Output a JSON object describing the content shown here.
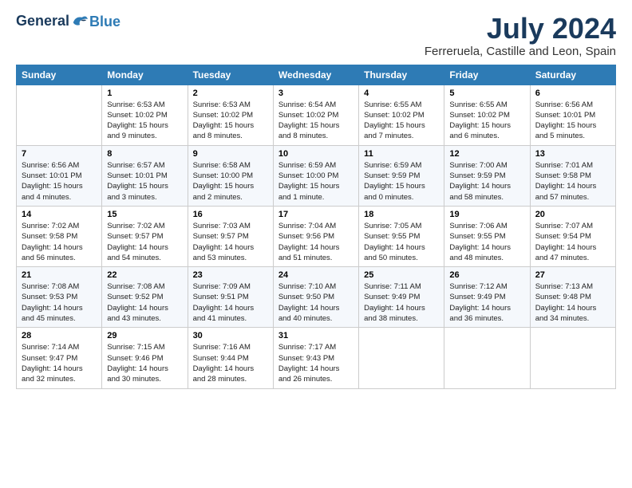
{
  "logo": {
    "line1": "General",
    "line2": "Blue"
  },
  "title": "July 2024",
  "subtitle": "Ferreruela, Castille and Leon, Spain",
  "days_header": [
    "Sunday",
    "Monday",
    "Tuesday",
    "Wednesday",
    "Thursday",
    "Friday",
    "Saturday"
  ],
  "weeks": [
    [
      {
        "num": "",
        "info": ""
      },
      {
        "num": "1",
        "info": "Sunrise: 6:53 AM\nSunset: 10:02 PM\nDaylight: 15 hours\nand 9 minutes."
      },
      {
        "num": "2",
        "info": "Sunrise: 6:53 AM\nSunset: 10:02 PM\nDaylight: 15 hours\nand 8 minutes."
      },
      {
        "num": "3",
        "info": "Sunrise: 6:54 AM\nSunset: 10:02 PM\nDaylight: 15 hours\nand 8 minutes."
      },
      {
        "num": "4",
        "info": "Sunrise: 6:55 AM\nSunset: 10:02 PM\nDaylight: 15 hours\nand 7 minutes."
      },
      {
        "num": "5",
        "info": "Sunrise: 6:55 AM\nSunset: 10:02 PM\nDaylight: 15 hours\nand 6 minutes."
      },
      {
        "num": "6",
        "info": "Sunrise: 6:56 AM\nSunset: 10:01 PM\nDaylight: 15 hours\nand 5 minutes."
      }
    ],
    [
      {
        "num": "7",
        "info": "Sunrise: 6:56 AM\nSunset: 10:01 PM\nDaylight: 15 hours\nand 4 minutes."
      },
      {
        "num": "8",
        "info": "Sunrise: 6:57 AM\nSunset: 10:01 PM\nDaylight: 15 hours\nand 3 minutes."
      },
      {
        "num": "9",
        "info": "Sunrise: 6:58 AM\nSunset: 10:00 PM\nDaylight: 15 hours\nand 2 minutes."
      },
      {
        "num": "10",
        "info": "Sunrise: 6:59 AM\nSunset: 10:00 PM\nDaylight: 15 hours\nand 1 minute."
      },
      {
        "num": "11",
        "info": "Sunrise: 6:59 AM\nSunset: 9:59 PM\nDaylight: 15 hours\nand 0 minutes."
      },
      {
        "num": "12",
        "info": "Sunrise: 7:00 AM\nSunset: 9:59 PM\nDaylight: 14 hours\nand 58 minutes."
      },
      {
        "num": "13",
        "info": "Sunrise: 7:01 AM\nSunset: 9:58 PM\nDaylight: 14 hours\nand 57 minutes."
      }
    ],
    [
      {
        "num": "14",
        "info": "Sunrise: 7:02 AM\nSunset: 9:58 PM\nDaylight: 14 hours\nand 56 minutes."
      },
      {
        "num": "15",
        "info": "Sunrise: 7:02 AM\nSunset: 9:57 PM\nDaylight: 14 hours\nand 54 minutes."
      },
      {
        "num": "16",
        "info": "Sunrise: 7:03 AM\nSunset: 9:57 PM\nDaylight: 14 hours\nand 53 minutes."
      },
      {
        "num": "17",
        "info": "Sunrise: 7:04 AM\nSunset: 9:56 PM\nDaylight: 14 hours\nand 51 minutes."
      },
      {
        "num": "18",
        "info": "Sunrise: 7:05 AM\nSunset: 9:55 PM\nDaylight: 14 hours\nand 50 minutes."
      },
      {
        "num": "19",
        "info": "Sunrise: 7:06 AM\nSunset: 9:55 PM\nDaylight: 14 hours\nand 48 minutes."
      },
      {
        "num": "20",
        "info": "Sunrise: 7:07 AM\nSunset: 9:54 PM\nDaylight: 14 hours\nand 47 minutes."
      }
    ],
    [
      {
        "num": "21",
        "info": "Sunrise: 7:08 AM\nSunset: 9:53 PM\nDaylight: 14 hours\nand 45 minutes."
      },
      {
        "num": "22",
        "info": "Sunrise: 7:08 AM\nSunset: 9:52 PM\nDaylight: 14 hours\nand 43 minutes."
      },
      {
        "num": "23",
        "info": "Sunrise: 7:09 AM\nSunset: 9:51 PM\nDaylight: 14 hours\nand 41 minutes."
      },
      {
        "num": "24",
        "info": "Sunrise: 7:10 AM\nSunset: 9:50 PM\nDaylight: 14 hours\nand 40 minutes."
      },
      {
        "num": "25",
        "info": "Sunrise: 7:11 AM\nSunset: 9:49 PM\nDaylight: 14 hours\nand 38 minutes."
      },
      {
        "num": "26",
        "info": "Sunrise: 7:12 AM\nSunset: 9:49 PM\nDaylight: 14 hours\nand 36 minutes."
      },
      {
        "num": "27",
        "info": "Sunrise: 7:13 AM\nSunset: 9:48 PM\nDaylight: 14 hours\nand 34 minutes."
      }
    ],
    [
      {
        "num": "28",
        "info": "Sunrise: 7:14 AM\nSunset: 9:47 PM\nDaylight: 14 hours\nand 32 minutes."
      },
      {
        "num": "29",
        "info": "Sunrise: 7:15 AM\nSunset: 9:46 PM\nDaylight: 14 hours\nand 30 minutes."
      },
      {
        "num": "30",
        "info": "Sunrise: 7:16 AM\nSunset: 9:44 PM\nDaylight: 14 hours\nand 28 minutes."
      },
      {
        "num": "31",
        "info": "Sunrise: 7:17 AM\nSunset: 9:43 PM\nDaylight: 14 hours\nand 26 minutes."
      },
      {
        "num": "",
        "info": ""
      },
      {
        "num": "",
        "info": ""
      },
      {
        "num": "",
        "info": ""
      }
    ]
  ]
}
